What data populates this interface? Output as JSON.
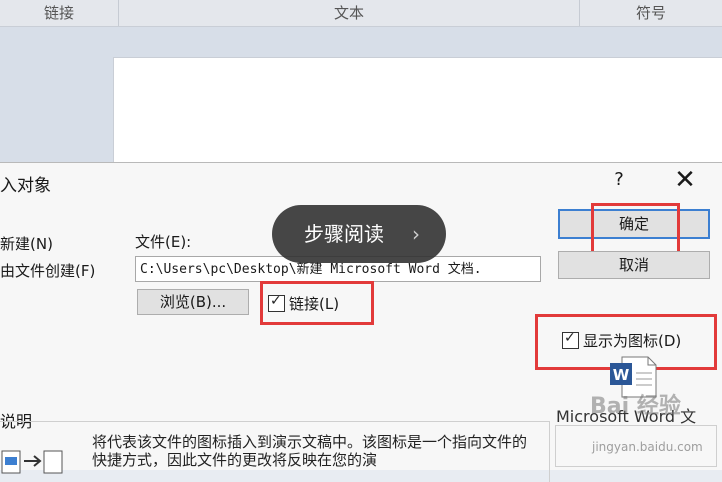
{
  "ribbon": {
    "groups": [
      "链接",
      "文本",
      "符号"
    ]
  },
  "dialog": {
    "title": "入对象",
    "help": "?",
    "close": "✕",
    "option_new": "新建(N)",
    "option_from_file": "由文件创建(F)",
    "file_label": "文件(E):",
    "file_path": "C:\\Users\\pc\\Desktop\\新建 Microsoft Word 文档.",
    "browse_button": "浏览(B)...",
    "link_checkbox": "链接(L)",
    "ok_button": "确定",
    "cancel_button": "取消",
    "display_as_icon": "显示为图标(D)",
    "preview_caption": "Microsoft Word 文",
    "result_label": "说明",
    "description": "将代表该文件的图标插入到演示文稿中。该图标是一个指向文件的快捷方式，因此文件的更改将反映在您的演"
  },
  "overlay": {
    "label": "步骤阅读",
    "chevron": "›"
  },
  "watermark": {
    "main": "Bai 经验",
    "sub": "jingyan.baidu.com"
  }
}
